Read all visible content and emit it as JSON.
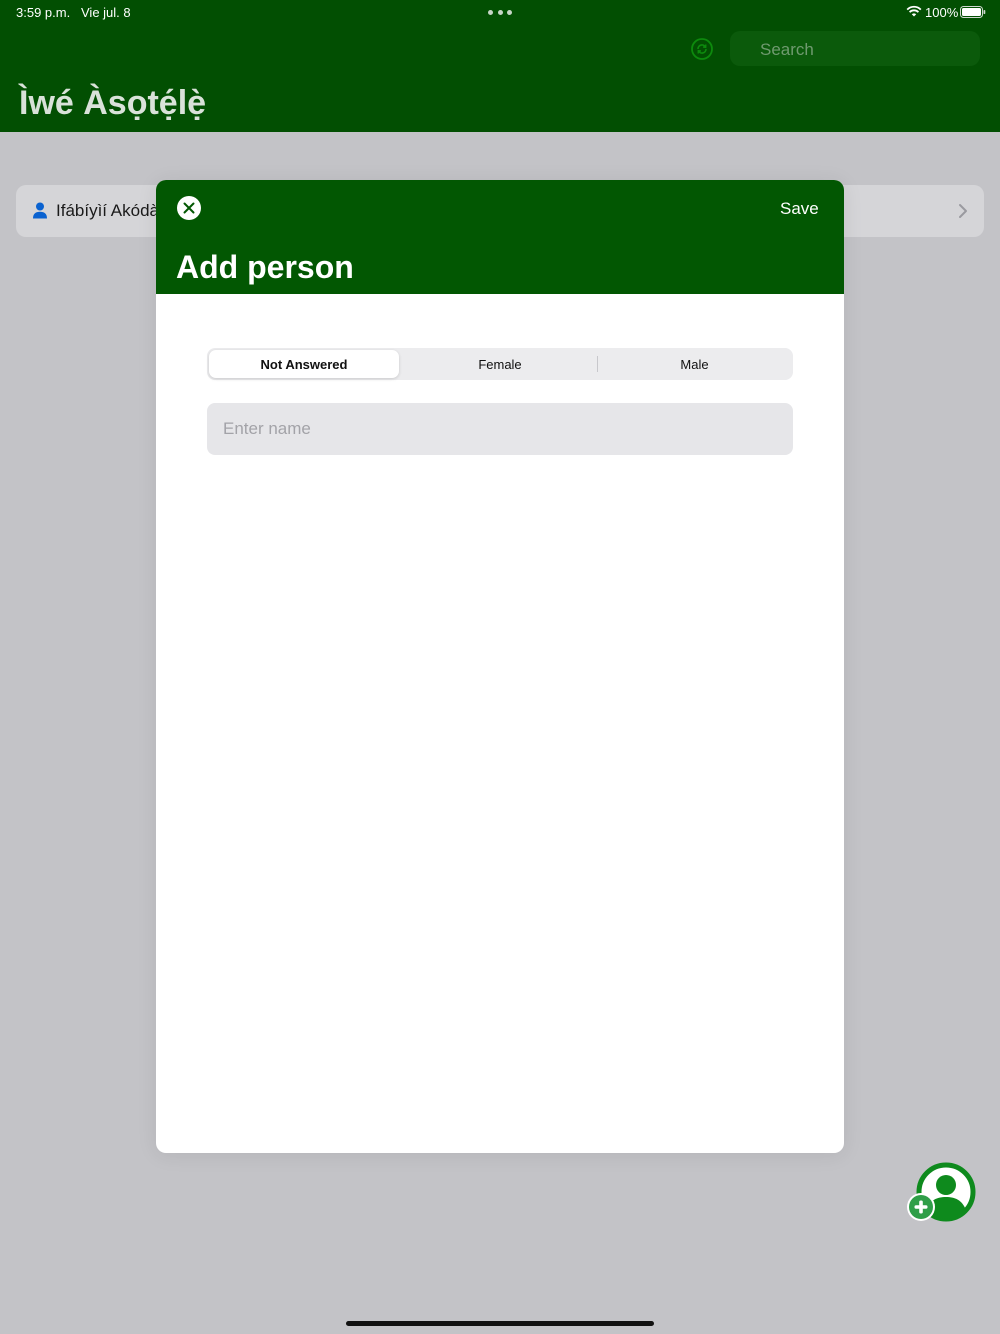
{
  "status_bar": {
    "time": "3:59 p.m.",
    "date": "Vie jul. 8",
    "battery": "100%"
  },
  "header": {
    "title": "Ìwé Àsọtẹ́lẹ̀",
    "search_placeholder": "Search",
    "sync_icon": "sync-icon"
  },
  "list": {
    "items": [
      {
        "name": "Ifábíyìí Akódà",
        "icon": "person-icon"
      }
    ]
  },
  "modal": {
    "title": "Add person",
    "save_label": "Save",
    "close_icon": "close-icon",
    "gender_segments": [
      "Not Answered",
      "Female",
      "Male"
    ],
    "selected_segment": "Not Answered",
    "name_placeholder": "Enter name",
    "name_value": ""
  },
  "fab": {
    "icon": "add-person-icon"
  },
  "colors": {
    "brand_green": "#024f02",
    "modal_header_green": "#025702",
    "accent_green": "#1f9a3a",
    "person_icon_blue": "#0a62d0"
  }
}
